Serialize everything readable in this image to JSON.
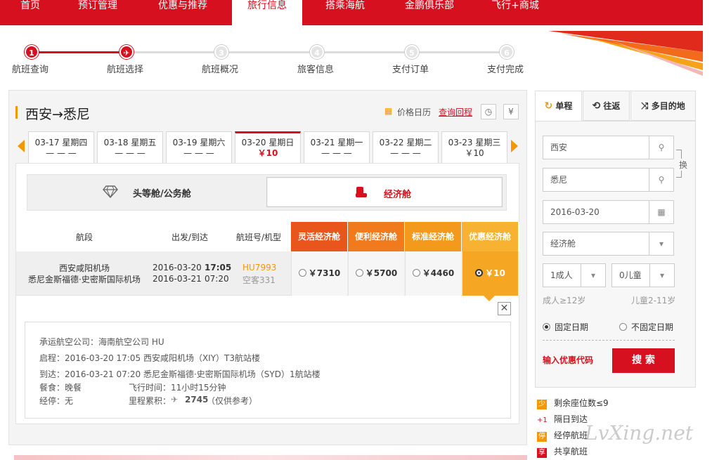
{
  "nav": {
    "items": [
      "首页",
      "预订管理",
      "优惠与推荐",
      "旅行信息",
      "搭乘海航",
      "金鹏俱乐部",
      "飞行+商城"
    ],
    "active_index": 3
  },
  "steps": {
    "items": [
      {
        "num": "1",
        "label": "航班查询"
      },
      {
        "num": "2",
        "label": "航班选择"
      },
      {
        "num": "3",
        "label": "航班概况"
      },
      {
        "num": "4",
        "label": "旅客信息"
      },
      {
        "num": "5",
        "label": "支付订单"
      },
      {
        "num": "6",
        "label": "支付完成"
      }
    ],
    "current": 2
  },
  "route": {
    "title": "西安→悉尼",
    "price_calendar": "价格日历",
    "query_return": "查询回程"
  },
  "dates": [
    {
      "date": "03-17 星期四",
      "price": "— — —"
    },
    {
      "date": "03-18 星期五",
      "price": "— — —"
    },
    {
      "date": "03-19 星期六",
      "price": "— — —"
    },
    {
      "date": "03-20 星期日",
      "price": "￥10"
    },
    {
      "date": "03-21 星期一",
      "price": "— — —"
    },
    {
      "date": "03-22 星期二",
      "price": "— — —"
    },
    {
      "date": "03-23 星期三",
      "price": "￥10"
    }
  ],
  "cabin": {
    "first_business": "头等舱/公务舱",
    "economy": "经济舱"
  },
  "table": {
    "headers": {
      "segment": "航段",
      "dep_arr": "出发/到达",
      "flight": "航班号/机型"
    },
    "fare_headers": [
      "灵活经济舱",
      "便利经济舱",
      "标准经济舱",
      "优惠经济舱"
    ],
    "row": {
      "origin": "西安咸阳机场",
      "destination": "悉尼金斯福德·史密斯国际机场",
      "dep_date": "2016-03-20",
      "dep_time": "17:05",
      "arr_date": "2016-03-21",
      "arr_time": "07:20",
      "flight_no": "HU7993",
      "aircraft": "空客331",
      "fares": [
        "￥7310",
        "￥5700",
        "￥4460",
        "￥10"
      ],
      "selected_fare": 3
    }
  },
  "detail": {
    "carrier": "承运航空公司：海南航空公司 HU",
    "depart": "启程：2016-03-20 17:05 西安咸阳机场（XIY）T3航站楼",
    "arrive": "到达：2016-03-21 07:20 悉尼金斯福德·史密斯国际机场（SYD）1航站楼",
    "meal": "餐食：晚餐",
    "duration": "飞行时间：11小时15分钟",
    "stop": "经停：无",
    "mileage_label": "里程累积：",
    "mileage_value": "2745",
    "mileage_note": "（仅供参考）"
  },
  "search": {
    "tabs": [
      "单程",
      "往返",
      "多目的地"
    ],
    "active_tab": 0,
    "from": "西安",
    "to": "悉尼",
    "swap": "换",
    "date": "2016-03-20",
    "cabin": "经济舱",
    "adults": "1成人",
    "children": "0儿童",
    "adult_hint": "成人≥12岁",
    "child_hint": "儿童2-11岁",
    "fixed_date": "固定日期",
    "flexible_date": "不固定日期",
    "promo": "输入优惠代码",
    "search_btn": "搜 索"
  },
  "legend": [
    {
      "icon": "少",
      "label": "剩余座位数≤9"
    },
    {
      "icon": "+1",
      "label": "隔日到达"
    },
    {
      "icon": "停",
      "label": "经停航班"
    },
    {
      "icon": "享",
      "label": "共享航班"
    }
  ],
  "watermark": "LvXing.net",
  "colors": {
    "brand_red": "#d6101f",
    "accent_orange": "#f39800",
    "selected_fare": "#f5a623"
  }
}
